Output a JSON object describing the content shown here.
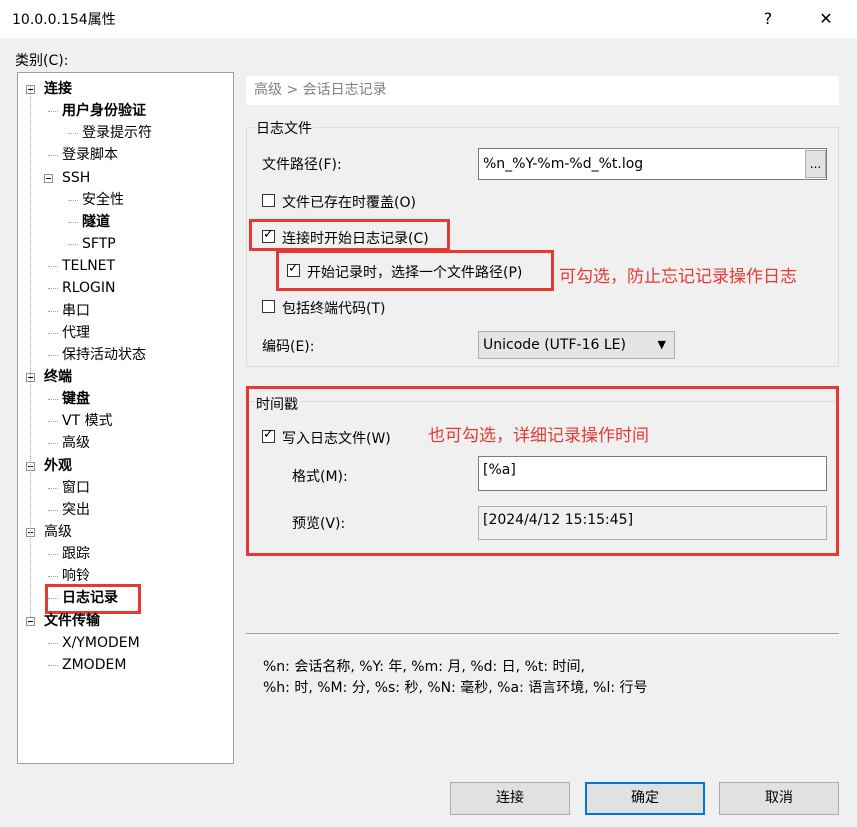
{
  "window": {
    "title": "10.0.0.154属性",
    "help_btn": "?",
    "close_btn": "✕"
  },
  "category_label": "类别(C):",
  "tree": [
    {
      "label": "连接",
      "bold": true,
      "level": 0,
      "expander": true
    },
    {
      "label": "用户身份验证",
      "bold": true,
      "level": 1,
      "expander": false
    },
    {
      "label": "登录提示符",
      "bold": false,
      "level": 2,
      "expander": false
    },
    {
      "label": "登录脚本",
      "bold": false,
      "level": 1,
      "expander": false
    },
    {
      "label": "SSH",
      "bold": false,
      "level": 1,
      "expander": true
    },
    {
      "label": "安全性",
      "bold": false,
      "level": 2,
      "expander": false
    },
    {
      "label": "隧道",
      "bold": true,
      "level": 2,
      "expander": false
    },
    {
      "label": "SFTP",
      "bold": false,
      "level": 2,
      "expander": false
    },
    {
      "label": "TELNET",
      "bold": false,
      "level": 1,
      "expander": false
    },
    {
      "label": "RLOGIN",
      "bold": false,
      "level": 1,
      "expander": false
    },
    {
      "label": "串口",
      "bold": false,
      "level": 1,
      "expander": false
    },
    {
      "label": "代理",
      "bold": false,
      "level": 1,
      "expander": false
    },
    {
      "label": "保持活动状态",
      "bold": false,
      "level": 1,
      "expander": false
    },
    {
      "label": "终端",
      "bold": true,
      "level": 0,
      "expander": true
    },
    {
      "label": "键盘",
      "bold": true,
      "level": 1,
      "expander": false
    },
    {
      "label": "VT 模式",
      "bold": false,
      "level": 1,
      "expander": false
    },
    {
      "label": "高级",
      "bold": false,
      "level": 1,
      "expander": false
    },
    {
      "label": "外观",
      "bold": true,
      "level": 0,
      "expander": true
    },
    {
      "label": "窗口",
      "bold": false,
      "level": 1,
      "expander": false
    },
    {
      "label": "突出",
      "bold": false,
      "level": 1,
      "expander": false
    },
    {
      "label": "高级",
      "bold": false,
      "level": 0,
      "expander": true
    },
    {
      "label": "跟踪",
      "bold": false,
      "level": 1,
      "expander": false
    },
    {
      "label": "响铃",
      "bold": false,
      "level": 1,
      "expander": false
    },
    {
      "label": "日志记录",
      "bold": true,
      "level": 1,
      "expander": false,
      "selected": true
    },
    {
      "label": "文件传输",
      "bold": true,
      "level": 0,
      "expander": true
    },
    {
      "label": "X/YMODEM",
      "bold": false,
      "level": 1,
      "expander": false
    },
    {
      "label": "ZMODEM",
      "bold": false,
      "level": 1,
      "expander": false
    }
  ],
  "breadcrumb": "高级 > 会话日志记录",
  "log_file": {
    "group_title": "日志文件",
    "path_label": "文件路径(F):",
    "path_value": "%n_%Y-%m-%d_%t.log",
    "browse_label": "...",
    "overwrite_label": "文件已存在时覆盖(O)",
    "overwrite_checked": false,
    "start_on_connect_label": "连接时开始日志记录(C)",
    "start_on_connect_checked": true,
    "choose_path_label": "开始记录时，选择一个文件路径(P)",
    "choose_path_checked": true,
    "include_terminal_codes_label": "包括终端代码(T)",
    "include_terminal_codes_checked": false,
    "encoding_label": "编码(E):",
    "encoding_value": "Unicode (UTF-16 LE)"
  },
  "timestamp": {
    "group_title": "时间戳",
    "write_label": "写入日志文件(W)",
    "write_checked": true,
    "format_label": "格式(M):",
    "format_value": "[%a]",
    "preview_label": "预览(V):",
    "preview_value": "[2024/4/12 15:15:45]"
  },
  "annotations": {
    "note1": "可勾选，防止忘记记录操作日志",
    "note2": "也可勾选，详细记录操作时间"
  },
  "help_text": {
    "line1": "%n: 会话名称, %Y: 年, %m: 月, %d: 日, %t: 时间,",
    "line2": " %h: 时, %M: 分, %s: 秒, %N: 毫秒, %a: 语言环境, %l: 行号"
  },
  "buttons": {
    "connect": "连接",
    "ok": "确定",
    "cancel": "取消"
  },
  "colors": {
    "annotation_red": "#e53935",
    "default_button_border": "#0078d7"
  }
}
